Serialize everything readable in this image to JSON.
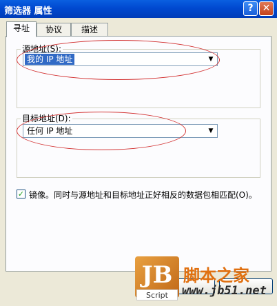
{
  "window": {
    "title": "筛选器 属性",
    "help_glyph": "?",
    "close_glyph": "✕"
  },
  "tabs": [
    {
      "label": "寻址",
      "active": true
    },
    {
      "label": "协议",
      "active": false
    },
    {
      "label": "描述",
      "active": false
    }
  ],
  "source": {
    "label": "源地址(S):",
    "value": "我的 IP 地址"
  },
  "destination": {
    "label": "目标地址(D):",
    "value": "任何 IP 地址"
  },
  "mirror": {
    "checked": true,
    "check_glyph": "✓",
    "label": "镜像。同时与源地址和目标地址正好相反的数据包相匹配(O)。"
  },
  "watermark": {
    "logo_text": "JB",
    "script_text": "Script",
    "site_name": "脚本之家",
    "url": "www.jb51.net"
  },
  "colors": {
    "titlebar": "#0049D0",
    "annotation": "#D23030",
    "selection": "#316AC5",
    "watermark_accent": "#E07010"
  }
}
